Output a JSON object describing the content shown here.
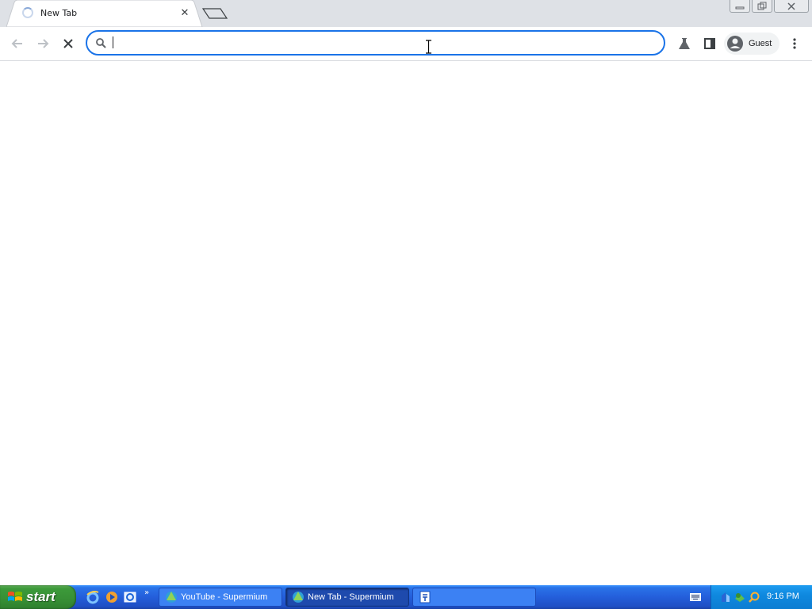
{
  "browser": {
    "tab": {
      "title": "New Tab",
      "loading": true
    },
    "omnibox": {
      "value": "",
      "placeholder": ""
    },
    "profile": {
      "label": "Guest"
    }
  },
  "taskbar": {
    "start_label": "start",
    "quick_launch": [
      "internet-explorer-icon",
      "media-player-icon",
      "outlook-express-icon"
    ],
    "tasks": [
      {
        "label": "YouTube - Supermium",
        "active": false
      },
      {
        "label": "New Tab - Supermium",
        "active": true
      },
      {
        "label": "",
        "active": false
      }
    ],
    "clock": "9:16 PM"
  },
  "colors": {
    "omnibox_focus": "#1a73e8",
    "tab_strip": "#dee1e6",
    "taskbar_blue": "#245edb",
    "start_green": "#3c9a3a"
  }
}
